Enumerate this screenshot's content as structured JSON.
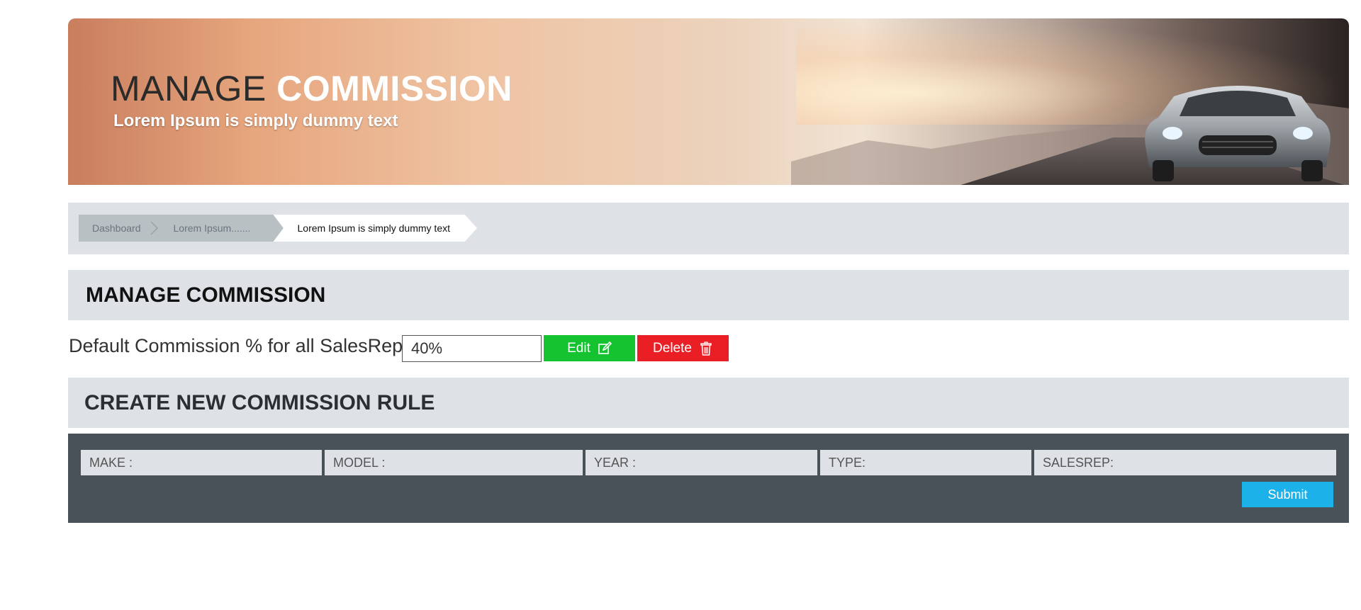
{
  "banner": {
    "title_plain": "MANAGE ",
    "title_strong": "COMMISSION",
    "subtitle": "Lorem Ipsum is simply dummy text"
  },
  "breadcrumb": {
    "items": [
      "Dashboard",
      "Lorem Ipsum.......",
      "Lorem Ipsum is simply dummy text"
    ]
  },
  "manage_section": {
    "title": "MANAGE COMMISSION",
    "default_label": "Default Commission % for all SalesRep",
    "default_value": "40%",
    "edit_label": "Edit",
    "delete_label": "Delete"
  },
  "create_section": {
    "title": "CREATE NEW COMMISSION RULE",
    "fields": {
      "make": "MAKE :",
      "model": "MODEL :",
      "year": "YEAR :",
      "type": "TYPE:",
      "salesrep": "SALESREP:"
    },
    "submit_label": "Submit"
  },
  "colors": {
    "edit": "#15c22f",
    "delete": "#ea1f25",
    "submit": "#1cb1e9",
    "panel": "#485258",
    "section_bg": "#dee2e6"
  },
  "icons": [
    "edit-icon",
    "trash-icon",
    "chevron-right-icon"
  ]
}
